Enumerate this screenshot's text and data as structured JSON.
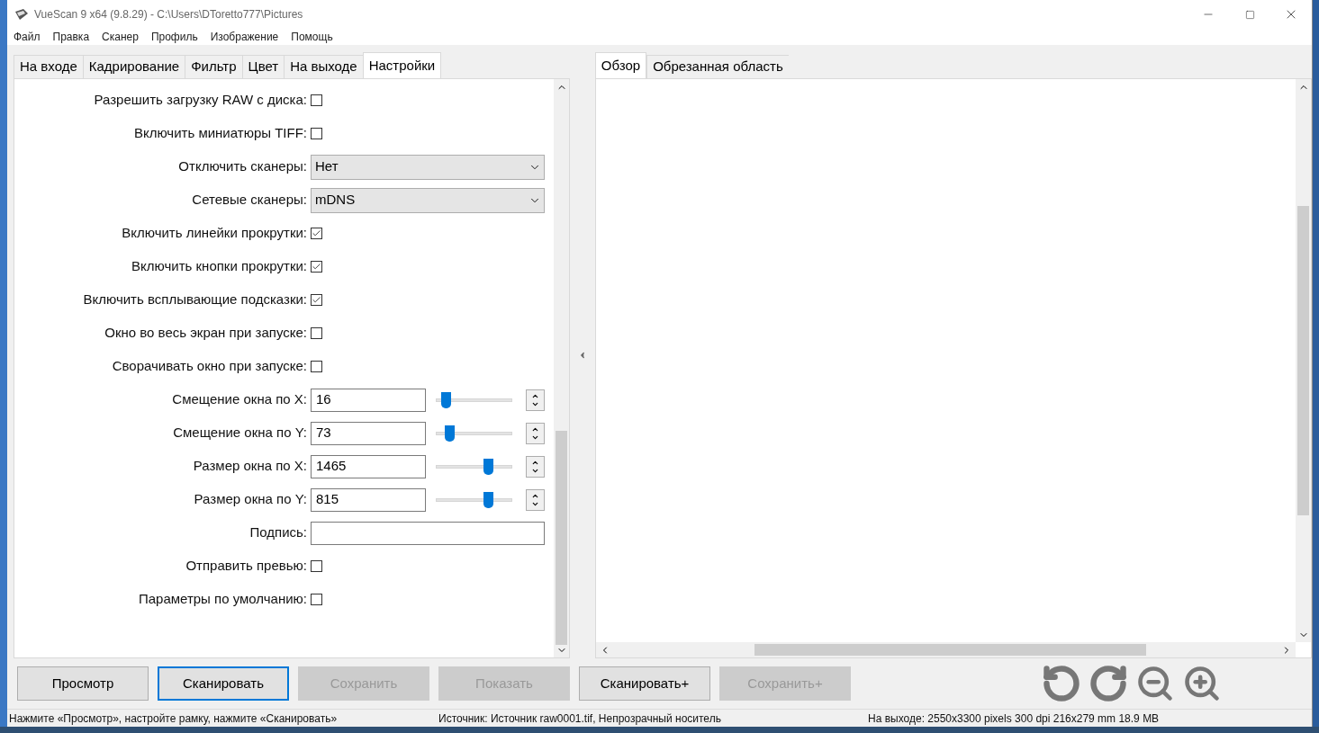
{
  "window": {
    "title": "VueScan 9 x64 (9.8.29) - C:\\Users\\DToretto777\\Pictures"
  },
  "menu": [
    "Файл",
    "Правка",
    "Сканер",
    "Профиль",
    "Изображение",
    "Помощь"
  ],
  "left_tabs": [
    {
      "label": "На входе",
      "selected": false
    },
    {
      "label": "Кадрирование",
      "selected": false
    },
    {
      "label": "Фильтр",
      "selected": false
    },
    {
      "label": "Цвет",
      "selected": false
    },
    {
      "label": "На выходе",
      "selected": false
    },
    {
      "label": "Настройки",
      "selected": true
    }
  ],
  "settings": [
    {
      "kind": "checkbox",
      "label": "Разрешить загрузку RAW с диска:",
      "checked": false
    },
    {
      "kind": "checkbox",
      "label": "Включить миниатюры TIFF:",
      "checked": false
    },
    {
      "kind": "dropdown",
      "label": "Отключить сканеры:",
      "value": "Нет"
    },
    {
      "kind": "dropdown",
      "label": "Сетевые сканеры:",
      "value": "mDNS"
    },
    {
      "kind": "checkbox",
      "label": "Включить линейки прокрутки:",
      "checked": true
    },
    {
      "kind": "checkbox",
      "label": "Включить кнопки прокрутки:",
      "checked": true
    },
    {
      "kind": "checkbox",
      "label": "Включить всплывающие подсказки:",
      "checked": true
    },
    {
      "kind": "checkbox",
      "label": "Окно во весь экран при запуске:",
      "checked": false
    },
    {
      "kind": "checkbox",
      "label": "Сворачивать окно при запуске:",
      "checked": false
    },
    {
      "kind": "slider",
      "label": "Смещение окна по X:",
      "value": "16",
      "level": 0.08
    },
    {
      "kind": "slider",
      "label": "Смещение окна по Y:",
      "value": "73",
      "level": 0.13
    },
    {
      "kind": "slider",
      "label": "Размер окна по X:",
      "value": "1465",
      "level": 0.72
    },
    {
      "kind": "slider",
      "label": "Размер окна по Y:",
      "value": "815",
      "level": 0.72
    },
    {
      "kind": "text",
      "label": "Подпись:"
    },
    {
      "kind": "checkbox",
      "label": "Отправить превью:",
      "checked": false
    },
    {
      "kind": "checkbox",
      "label": "Параметры по умолчанию:",
      "checked": false
    }
  ],
  "right_tabs": [
    {
      "label": "Обзор",
      "selected": true
    },
    {
      "label": "Обрезанная область",
      "selected": false
    }
  ],
  "buttons": [
    {
      "label": "Просмотр",
      "disabled": false,
      "focused": false
    },
    {
      "label": "Сканировать",
      "disabled": false,
      "focused": true
    },
    {
      "label": "Сохранить",
      "disabled": true,
      "focused": false
    },
    {
      "label": "Показать",
      "disabled": true,
      "focused": false
    },
    {
      "label": "Сканировать+",
      "disabled": false,
      "focused": false
    },
    {
      "label": "Сохранить+",
      "disabled": true,
      "focused": false
    }
  ],
  "status_bar": [
    "Нажмите «Просмотр», настройте рамку, нажмите «Сканировать»",
    "Источник: Источник raw0001.tif, Непрозрачный носитель",
    "На выходе: 2550x3300 pixels 300 dpi 216x279 mm 18.9 MB"
  ]
}
